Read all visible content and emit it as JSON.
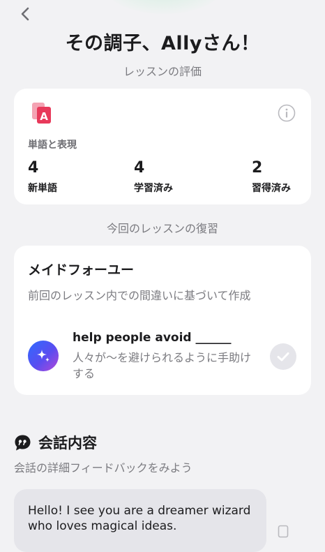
{
  "header": {
    "back_icon": "chevron-left-icon",
    "title": "その調子、Allyさん！",
    "evaluation_label": "レッスンの評価"
  },
  "vocab_card": {
    "app_icon": "vocabulary-cards-icon",
    "info_icon": "info-icon",
    "section_label": "単語と表現",
    "stats": [
      {
        "value": "4",
        "label": "新単語"
      },
      {
        "value": "4",
        "label": "学習済み"
      },
      {
        "value": "2",
        "label": "習得済み"
      }
    ]
  },
  "review": {
    "heading": "今回のレッスンの復習",
    "card_title": "メイドフォーユー",
    "card_description": "前回のレッスン内での間違いに基づいて作成",
    "item": {
      "icon": "sparkle-icon",
      "phrase": "help people avoid ______",
      "translation": "人々が〜を避けられるように手助けする",
      "status_icon": "checkmark-icon"
    }
  },
  "conversation": {
    "icon": "speech-quote-icon",
    "title": "会話内容",
    "subtitle": "会話の詳細フィードバックをみよう",
    "message": "Hello! I see you are a dreamer wizard who loves magical ideas.",
    "copy_icon": "copy-icon"
  },
  "colors": {
    "background": "#f2f2f4",
    "card": "#ffffff",
    "accent_pink": "#e8395a",
    "secondary_text": "#7b7b80"
  }
}
